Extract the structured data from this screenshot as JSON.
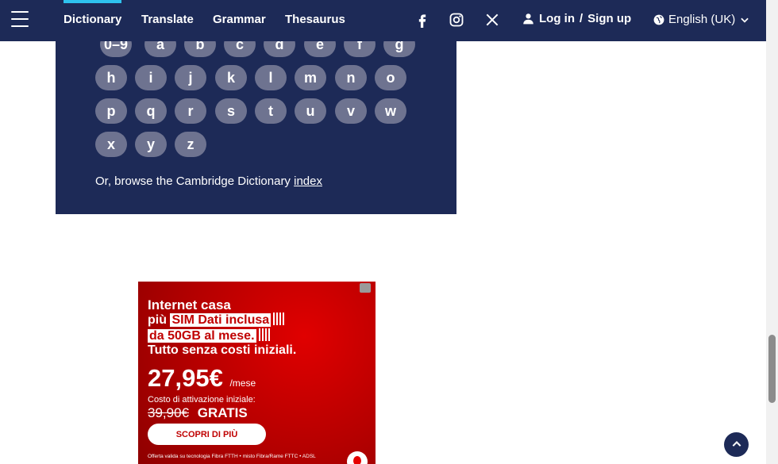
{
  "header": {
    "menu_icon": "hamburger-menu-icon",
    "tabs": [
      "Dictionary",
      "Translate",
      "Grammar",
      "Thesaurus"
    ],
    "social": [
      "facebook-icon",
      "instagram-icon",
      "x-icon"
    ],
    "login_label": "Log in",
    "separator": "/",
    "signup_label": "Sign up",
    "language_label": "English (UK)"
  },
  "browse": {
    "letters": [
      "0–9",
      "a",
      "b",
      "c",
      "d",
      "e",
      "f",
      "g",
      "h",
      "i",
      "j",
      "k",
      "l",
      "m",
      "n",
      "o",
      "p",
      "q",
      "r",
      "s",
      "t",
      "u",
      "v",
      "w",
      "x",
      "y",
      "z"
    ],
    "text": "Or, browse the Cambridge Dictionary",
    "link": "index"
  },
  "ad": {
    "line1": "Internet casa",
    "line2_prefix": "più",
    "line2_highlight": "SIM Dati inclusa",
    "line3_highlight": "da 50GB al mese.",
    "line4": "Tutto senza costi iniziali.",
    "price": "27,95€",
    "price_unit": "/mese",
    "activation_label": "Costo di attivazione iniziale:",
    "old_price": "39,90€",
    "free_label": "GRATIS",
    "cta": "SCOPRI DI PIÙ",
    "fine_print": "Offerta valida su tecnologia Fibra FTTH • misto Fibra/Rame FTTC • ADSL"
  },
  "colors": {
    "brand_navy": "#1d2a57",
    "letter_pill": "#6e7390",
    "active_tab_accent": "#2ec2ee",
    "ad_red": "#c00000"
  },
  "back_to_top_icon": "back-to-top-icon"
}
